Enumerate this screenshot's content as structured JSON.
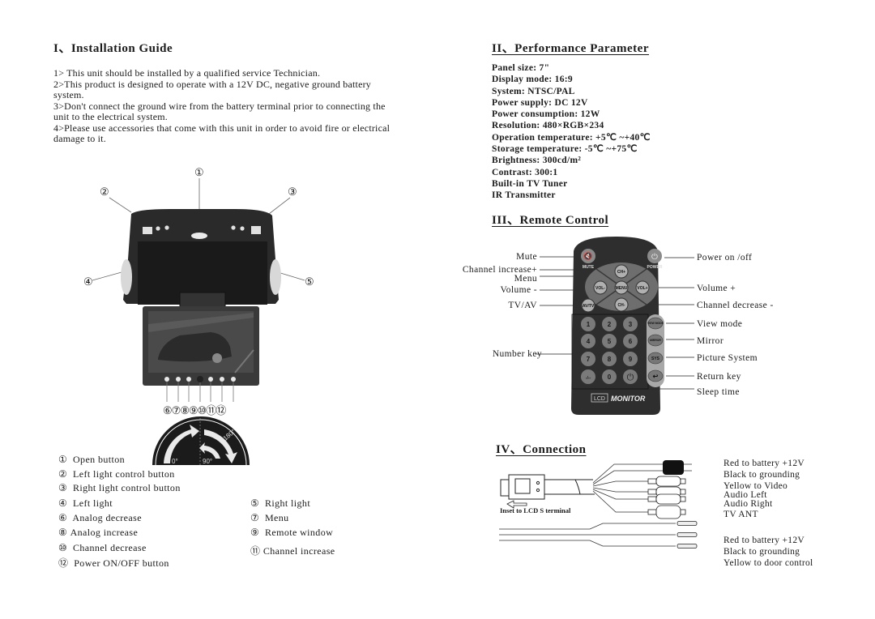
{
  "installation": {
    "title": "I、Installation Guide",
    "items": [
      "1> This unit should be installed by a qualified service Technician.",
      "2>This product is designed to operate with a 12V DC, negative ground battery system.",
      "3>Don't connect the ground wire from the battery terminal prior to connecting the unit to the electrical system.",
      "4>Please use accessories that come with this unit  in order to avoid fire or electrical damage to it."
    ],
    "callouts": [
      "①",
      "②",
      "③",
      "④",
      "⑤",
      "⑥",
      "⑦",
      "⑧",
      "⑨",
      "⑩",
      "⑪",
      "⑫"
    ],
    "rotation_labels": {
      "a": "0°",
      "b": "90°",
      "c": "180°"
    },
    "parts_left": [
      {
        "num": "①",
        "label": "Open button"
      },
      {
        "num": "②",
        "label": "Left light control button"
      },
      {
        "num": "③",
        "label": "Right light control button"
      },
      {
        "num": "④",
        "label": "Left light"
      },
      {
        "num": "⑥",
        "label": "Analog decrease"
      },
      {
        "num": "⑧",
        "label": "Analog increase"
      },
      {
        "num": "⑩",
        "label": "Channel decrease"
      },
      {
        "num": "⑫",
        "label": "Power ON/OFF button"
      }
    ],
    "parts_right": [
      {
        "num": "⑤",
        "label": "Right light"
      },
      {
        "num": "⑦",
        "label": "Menu"
      },
      {
        "num": "⑨",
        "label": "Remote window"
      },
      {
        "num": "⑪",
        "label": "Channel increase"
      }
    ]
  },
  "performance": {
    "title": "II、Performance Parameter",
    "specs": [
      "Panel size: 7\"",
      "Display mode: 16:9",
      "System: NTSC/PAL",
      "Power supply: DC 12V",
      "Power consumption: 12W",
      "Resolution: 480×RGB×234",
      "Operation temperature: +5℃ ~+40℃",
      "Storage temperature: -5℃ ~+75℃",
      "Brightness: 300cd/m²",
      "Contrast: 300:1",
      "Built-in TV Tuner",
      "IR Transmitter"
    ]
  },
  "remote": {
    "title": "III、Remote Control",
    "left_labels": [
      "Mute",
      "Channel increase+",
      "Menu",
      "Volume -",
      "TV/AV",
      "Number key"
    ],
    "right_labels": [
      "Power on /off",
      "Volume +",
      "Channel decrease -",
      "View mode",
      "Mirror",
      "Picture System",
      "Return key",
      "Sleep time"
    ],
    "buttons": {
      "mute": "MUTE",
      "power": "POWER",
      "ch_up": "CH+",
      "ch_down": "CH-",
      "vol_down": "VOL-",
      "vol_up": "VOL+",
      "menu": "MENU",
      "avtv": "AV/TV",
      "digits": [
        "1",
        "2",
        "3",
        "4",
        "5",
        "6",
        "7",
        "8",
        "9",
        "-/--",
        "0"
      ],
      "side": [
        "VIEW MODE",
        "MIRROR",
        "SYS",
        "↩"
      ],
      "brand_lcd": "LCD",
      "brand_monitor": "MONITOR"
    }
  },
  "connection": {
    "title": "IV、Connection",
    "connector_caption": "Inset to LCD S terminal",
    "group1": [
      "Red to battery +12V",
      "Black to grounding",
      "Yellow to Video",
      "Audio Left",
      "Audio Right",
      "TV ANT"
    ],
    "group2": [
      "Red to battery +12V",
      "Black to grounding",
      "Yellow to door control"
    ]
  }
}
